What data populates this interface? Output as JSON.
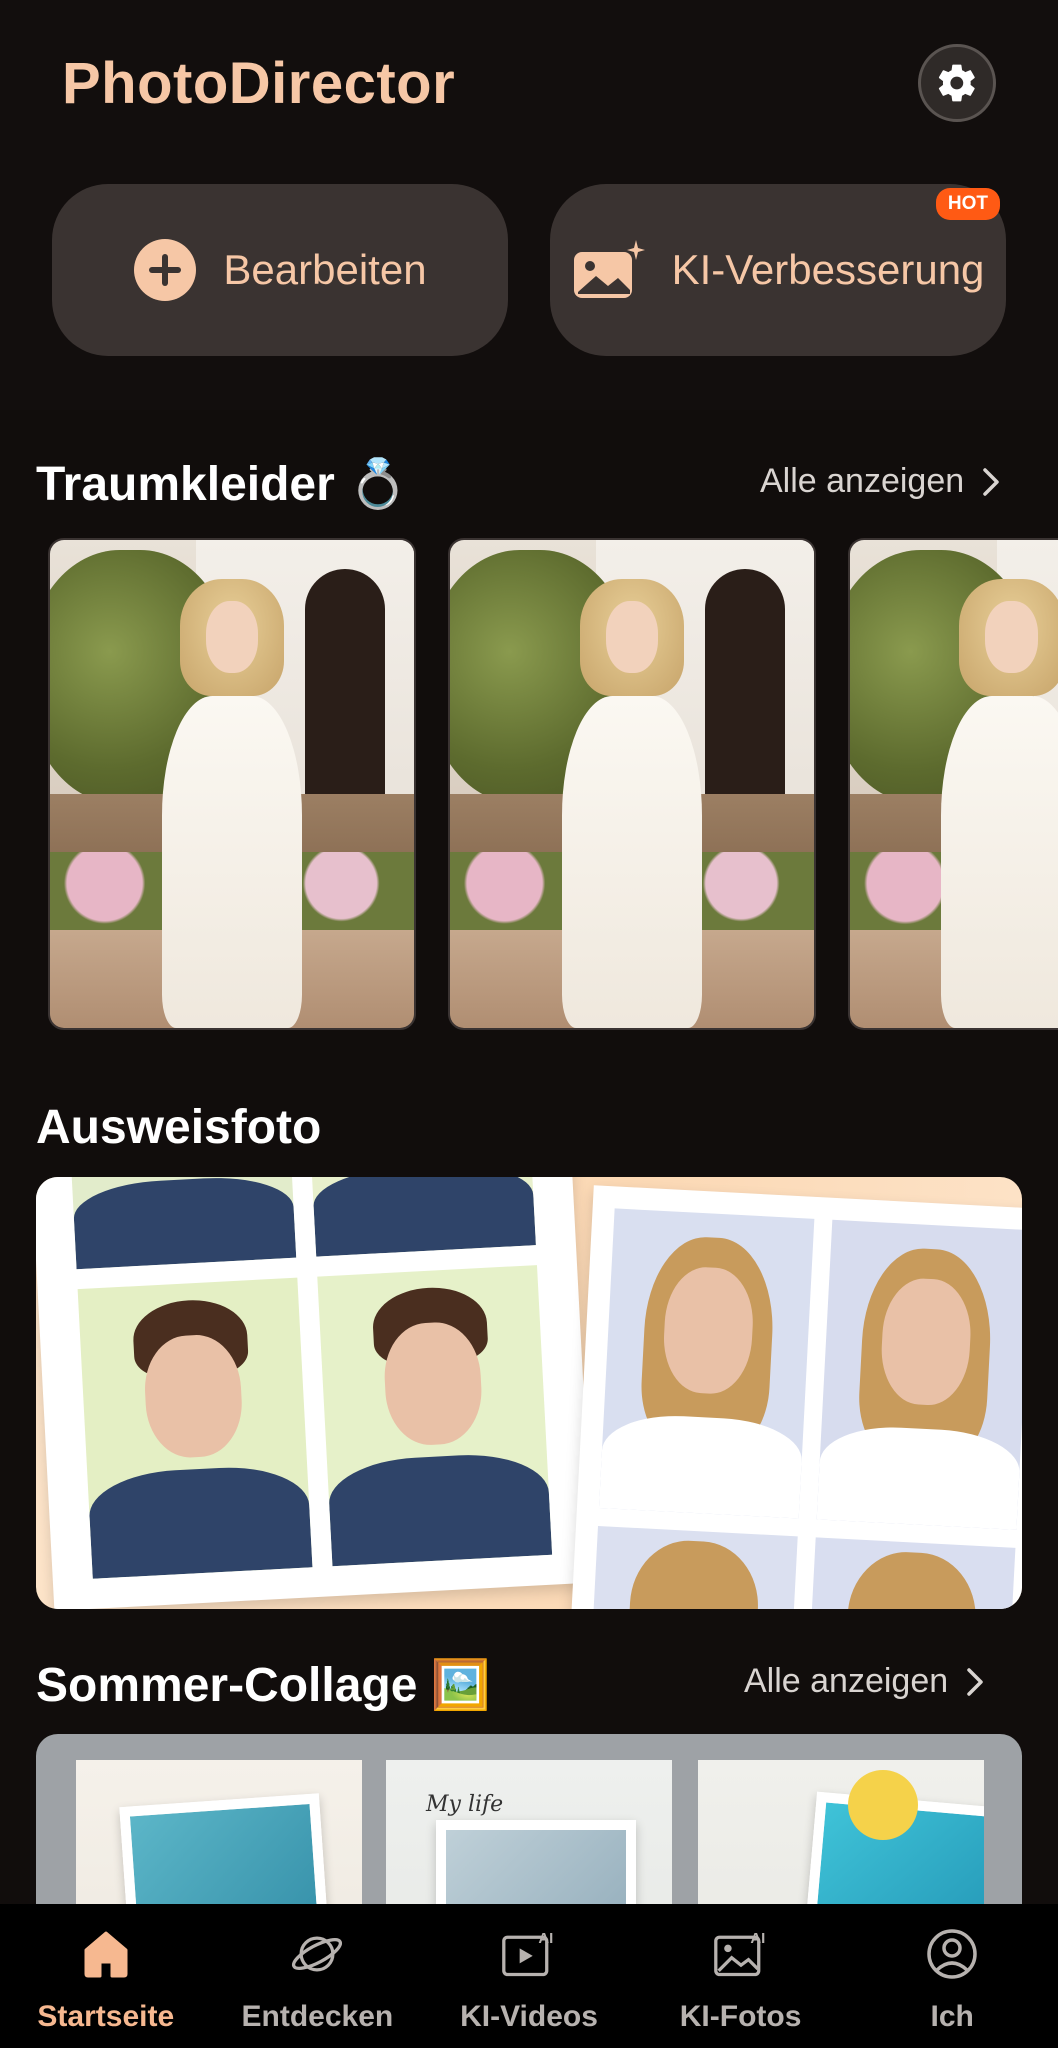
{
  "app": {
    "title": "PhotoDirector"
  },
  "actions": {
    "edit_label": "Bearbeiten",
    "ai_label": "KI-Verbesserung",
    "ai_badge": "HOT"
  },
  "sections": {
    "dresses": {
      "title": "Traumkleider 💍",
      "see_all": "Alle anzeigen"
    },
    "idphoto": {
      "title": "Ausweisfoto"
    },
    "collage": {
      "title": "Sommer-Collage 🖼️",
      "see_all": "Alle anzeigen",
      "item2_text": "My life"
    }
  },
  "nav": {
    "items": [
      {
        "label": "Startseite",
        "icon": "home-icon",
        "active": true
      },
      {
        "label": "Entdecken",
        "icon": "planet-icon",
        "active": false
      },
      {
        "label": "KI-Videos",
        "icon": "ai-video-icon",
        "active": false
      },
      {
        "label": "KI-Fotos",
        "icon": "ai-photo-icon",
        "active": false
      },
      {
        "label": "Ich",
        "icon": "profile-icon",
        "active": false
      }
    ]
  },
  "colors": {
    "accent": "#f6c7a6",
    "active_nav": "#f6b890",
    "hot_badge": "#ff5a14",
    "background": "#110d0c"
  }
}
